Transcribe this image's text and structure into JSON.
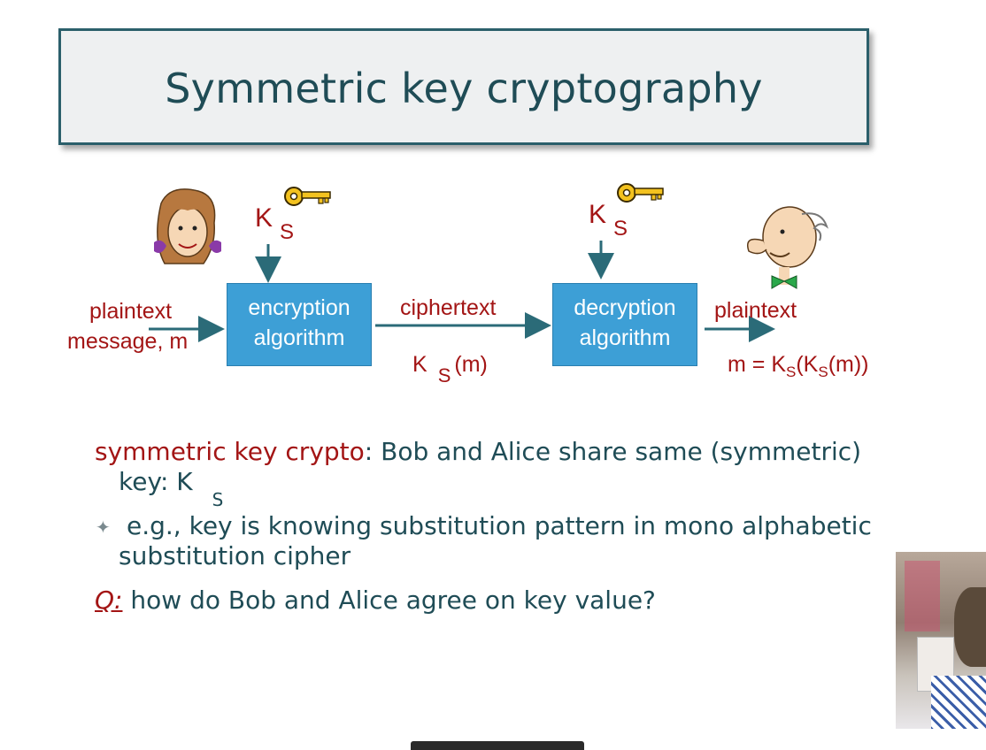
{
  "title": "Symmetric key cryptography",
  "diagram": {
    "left_plaintext": [
      "plaintext",
      "message, m"
    ],
    "enc_box": [
      "encryption",
      "algorithm"
    ],
    "ciphertext_label": "ciphertext",
    "dec_box": [
      "decryption",
      "algorithm"
    ],
    "right_plaintext": "plaintext",
    "key_left": {
      "main": "K",
      "sub": "S"
    },
    "key_right": {
      "main": "K",
      "sub": "S"
    },
    "cipher_formula": {
      "main": "K",
      "sub": "S",
      "rest": "(m)"
    },
    "result_formula": {
      "prefix": "m = K",
      "sub1": "S",
      "mid": "(K",
      "sub2": "S",
      "suffix": "(m))"
    }
  },
  "bullets": {
    "line1_red": "symmetric key crypto",
    "line1_rest": ": Bob and Alice share same (symmetric)",
    "line2_main": "key: K",
    "line2_sub": "S",
    "bullet_mark": "✦",
    "line3": "e.g., key is knowing substitution pattern in mono alphabetic",
    "line4": "substitution cipher",
    "q_label": "Q:",
    "q_rest": " how do Bob and Alice agree on key value?"
  },
  "colors": {
    "title": "#1f4c56",
    "red": "#a31515",
    "box": "#3d9fd6",
    "arrow": "#2b6b78"
  }
}
